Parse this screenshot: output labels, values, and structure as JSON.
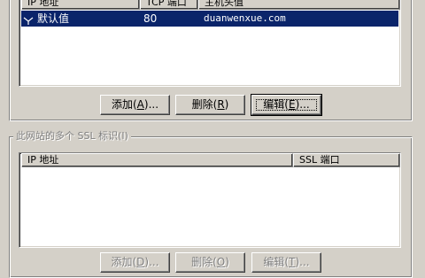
{
  "top_list": {
    "columns": [
      "IP 地址",
      "TCP 端口",
      "主机头值"
    ],
    "rows": [
      {
        "ip": "默认值",
        "port": "80",
        "host": "duanwenxue.com",
        "selected": true
      }
    ]
  },
  "top_buttons": {
    "add": {
      "label": "添加",
      "hotkey": "A",
      "suffix": "..."
    },
    "remove": {
      "label": "删除",
      "hotkey": "R",
      "suffix": ""
    },
    "edit": {
      "label": "编辑",
      "hotkey": "E",
      "suffix": "..."
    }
  },
  "ssl_group": {
    "legend": "此网站的多个 SSL 标识(I)",
    "columns": [
      "IP 地址",
      "SSL 端口"
    ],
    "rows": []
  },
  "ssl_buttons": {
    "add": {
      "label": "添加",
      "hotkey": "D",
      "suffix": "..."
    },
    "remove": {
      "label": "删除",
      "hotkey": "O",
      "suffix": ""
    },
    "edit": {
      "label": "编辑",
      "hotkey": "T",
      "suffix": "..."
    }
  }
}
